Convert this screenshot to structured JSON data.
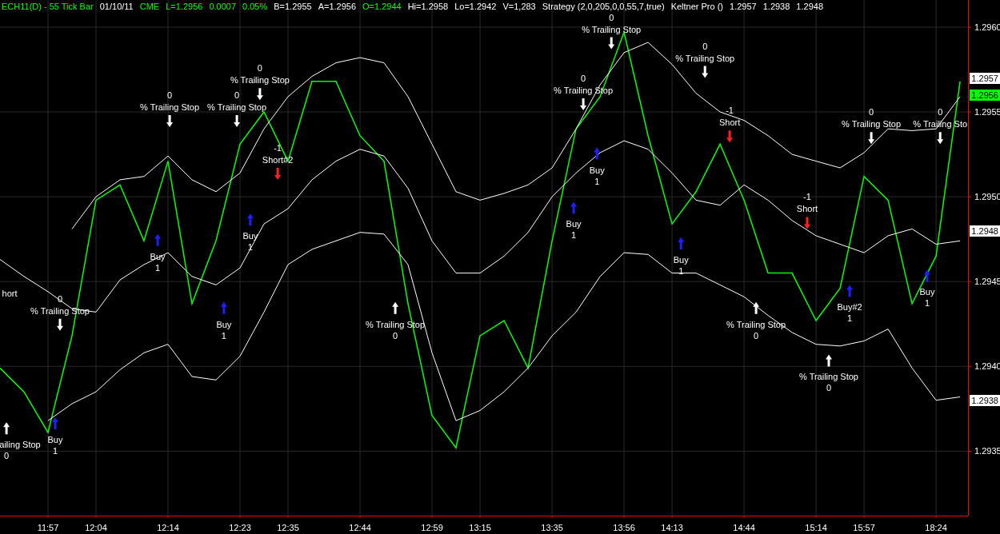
{
  "header": [
    {
      "text": "ECH11(D) - 55 Tick Bar",
      "color": "#00ff00"
    },
    {
      "text": "01/10/11",
      "color": "#ffffff"
    },
    {
      "text": "CME",
      "color": "#00ff00"
    },
    {
      "text": "L=1.2956",
      "color": "#00ff00"
    },
    {
      "text": "0.0007",
      "color": "#00ff00"
    },
    {
      "text": "0.05%",
      "color": "#00ff00"
    },
    {
      "text": "B=1.2955",
      "color": "#ffffff"
    },
    {
      "text": "A=1.2956",
      "color": "#ffffff"
    },
    {
      "text": "O=1.2944",
      "color": "#00ff00"
    },
    {
      "text": "Hi=1.2958",
      "color": "#ffffff"
    },
    {
      "text": "Lo=1.2942",
      "color": "#ffffff"
    },
    {
      "text": "V=1,283",
      "color": "#ffffff"
    },
    {
      "text": "Strategy (2,0,205,0,0,55,7,true)",
      "color": "#ffffff"
    },
    {
      "text": "Keltner Pro ()",
      "color": "#ffffff"
    },
    {
      "text": "1.2957",
      "color": "#ffffff"
    },
    {
      "text": "1.2938",
      "color": "#ffffff"
    },
    {
      "text": "1.2948",
      "color": "#ffffff"
    }
  ],
  "chart_data": {
    "type": "line",
    "categories": [
      null,
      null,
      "11:57",
      null,
      "12:04",
      null,
      null,
      "12:14",
      null,
      null,
      "12:23",
      null,
      "12:35",
      null,
      null,
      "12:44",
      null,
      null,
      "12:59",
      null,
      "13:15",
      null,
      null,
      "13:35",
      null,
      null,
      "13:56",
      null,
      "14:13",
      null,
      null,
      "14:44",
      null,
      null,
      "15:14",
      null,
      "15:57",
      null,
      null,
      "18:24",
      null
    ],
    "series": [
      {
        "color": "#00ff00",
        "values": [
          1.29399,
          1.29385,
          1.29361,
          1.29418,
          1.29498,
          1.29507,
          1.29474,
          1.29521,
          1.29437,
          1.29474,
          1.29531,
          1.2955,
          1.29521,
          1.29568,
          1.29568,
          1.29536,
          1.29521,
          1.29437,
          1.29371,
          1.29352,
          1.29418,
          1.29427,
          1.29399,
          1.29474,
          1.2954,
          1.29559,
          1.29597,
          1.29536,
          1.29484,
          1.29503,
          1.29531,
          1.29498,
          1.29455,
          1.29455,
          1.29427,
          1.29446,
          1.29512,
          1.29498,
          1.29437,
          1.29465,
          1.29568
        ]
      },
      {
        "color": "#ffffff",
        "values": [
          null,
          null,
          null,
          1.29481,
          1.295,
          1.2951,
          1.29512,
          1.29524,
          1.2951,
          1.29503,
          1.29514,
          1.2954,
          1.29559,
          1.29571,
          1.29579,
          1.29582,
          1.29579,
          1.29559,
          1.29531,
          1.29503,
          1.29498,
          1.29502,
          1.29507,
          1.29517,
          1.2954,
          1.29566,
          1.29585,
          1.29591,
          1.29578,
          1.29561,
          1.2955,
          1.29545,
          1.29536,
          1.29525,
          1.29521,
          1.29517,
          1.29526,
          1.2954,
          1.29539,
          1.2954,
          1.29559
        ]
      },
      {
        "color": "#ffffff",
        "values": [
          1.29463,
          1.29453,
          1.29444,
          1.29434,
          1.29432,
          1.29451,
          1.2946,
          1.29467,
          1.29453,
          1.29448,
          1.29458,
          1.29484,
          1.29493,
          1.2951,
          1.29521,
          1.29528,
          1.29524,
          1.29505,
          1.29474,
          1.29455,
          1.29455,
          1.29465,
          1.29479,
          1.295,
          1.29514,
          1.29526,
          1.29533,
          1.29528,
          1.29514,
          1.29498,
          1.29495,
          1.29507,
          1.29498,
          1.29486,
          1.29477,
          1.29472,
          1.29467,
          1.29477,
          1.29481,
          1.29472,
          1.29474
        ]
      },
      {
        "color": "#ffffff",
        "values": [
          null,
          null,
          1.29368,
          1.29378,
          1.29385,
          1.29398,
          1.29408,
          1.29413,
          1.29394,
          1.29392,
          1.29406,
          1.29432,
          1.2946,
          1.29469,
          1.29474,
          1.29479,
          1.29478,
          1.2946,
          1.29408,
          1.29368,
          1.29374,
          1.29385,
          1.29399,
          1.29418,
          1.29432,
          1.29453,
          1.29467,
          1.29466,
          1.29455,
          1.29455,
          1.29448,
          1.29441,
          1.2943,
          1.2942,
          1.29413,
          1.29412,
          1.29415,
          1.29422,
          1.29399,
          1.2938,
          1.29382
        ]
      }
    ],
    "ylim": [
      1.29312,
      1.29616
    ],
    "grid": true,
    "yticks": [
      {
        "value": 1.2935,
        "label": "1.2935"
      },
      {
        "value": 1.294,
        "label": "1.2940"
      },
      {
        "value": 1.2945,
        "label": "1.2945"
      },
      {
        "value": 1.295,
        "label": "1.2950"
      },
      {
        "value": 1.2955,
        "label": "1.2955"
      },
      {
        "value": 1.296,
        "label": "1.2960"
      }
    ]
  },
  "signals": [
    {
      "kind": "text",
      "label": "hort"
    },
    {
      "kind": "exit_long",
      "label": "% Trailing Stop",
      "qty": "0"
    },
    {
      "kind": "exit_short",
      "label": "ailing Stop",
      "qty": "0"
    },
    {
      "kind": "buy",
      "label": "Buy",
      "qty": "1"
    },
    {
      "kind": "exit_long",
      "label": "% Trailing Stop",
      "qty": "0"
    },
    {
      "kind": "buy",
      "label": "Buy",
      "qty": "1"
    },
    {
      "kind": "exit_long",
      "label": "% Trailing Stop",
      "qty": "0"
    },
    {
      "kind": "exit_long",
      "label": "% Trailing Stop",
      "qty": "0"
    },
    {
      "kind": "short",
      "label": "Short#2",
      "qty": "-1"
    },
    {
      "kind": "buy",
      "label": "Buy",
      "qty": "1"
    },
    {
      "kind": "buy",
      "label": "Buy",
      "qty": "1"
    },
    {
      "kind": "exit_short",
      "label": "% Trailing Stop",
      "qty": "0"
    },
    {
      "kind": "exit_long",
      "label": "% Trailing Stop",
      "qty": "0"
    },
    {
      "kind": "exit_long",
      "label": "% Trailing Stop",
      "qty": "0"
    },
    {
      "kind": "buy",
      "label": "Buy",
      "qty": "1"
    },
    {
      "kind": "buy",
      "label": "Buy",
      "qty": "1"
    },
    {
      "kind": "exit_long",
      "label": "% Trailing Stop",
      "qty": "0"
    },
    {
      "kind": "short",
      "label": "Short",
      "qty": "-1"
    },
    {
      "kind": "buy",
      "label": "Buy",
      "qty": "1"
    },
    {
      "kind": "exit_short",
      "label": "% Trailing Stop",
      "qty": "0"
    },
    {
      "kind": "short",
      "label": "Short",
      "qty": "-1"
    },
    {
      "kind": "exit_long",
      "label": "% Trailing Stop",
      "qty": "0"
    },
    {
      "kind": "buy",
      "label": "Buy#2",
      "qty": "1"
    },
    {
      "kind": "exit_short",
      "label": "% Trailing Stop",
      "qty": "0"
    },
    {
      "kind": "exit_long",
      "label": "% Trailing Sto",
      "qty": "0"
    },
    {
      "kind": "buy",
      "label": "Buy",
      "qty": "1"
    }
  ],
  "price_tags": [
    {
      "label": "1.2957",
      "color": "#ffffff"
    },
    {
      "label": "1.2956",
      "color": "#00ff00"
    },
    {
      "label": "1.2948",
      "color": "#ffffff"
    },
    {
      "label": "1.2938",
      "color": "#ffffff"
    }
  ]
}
